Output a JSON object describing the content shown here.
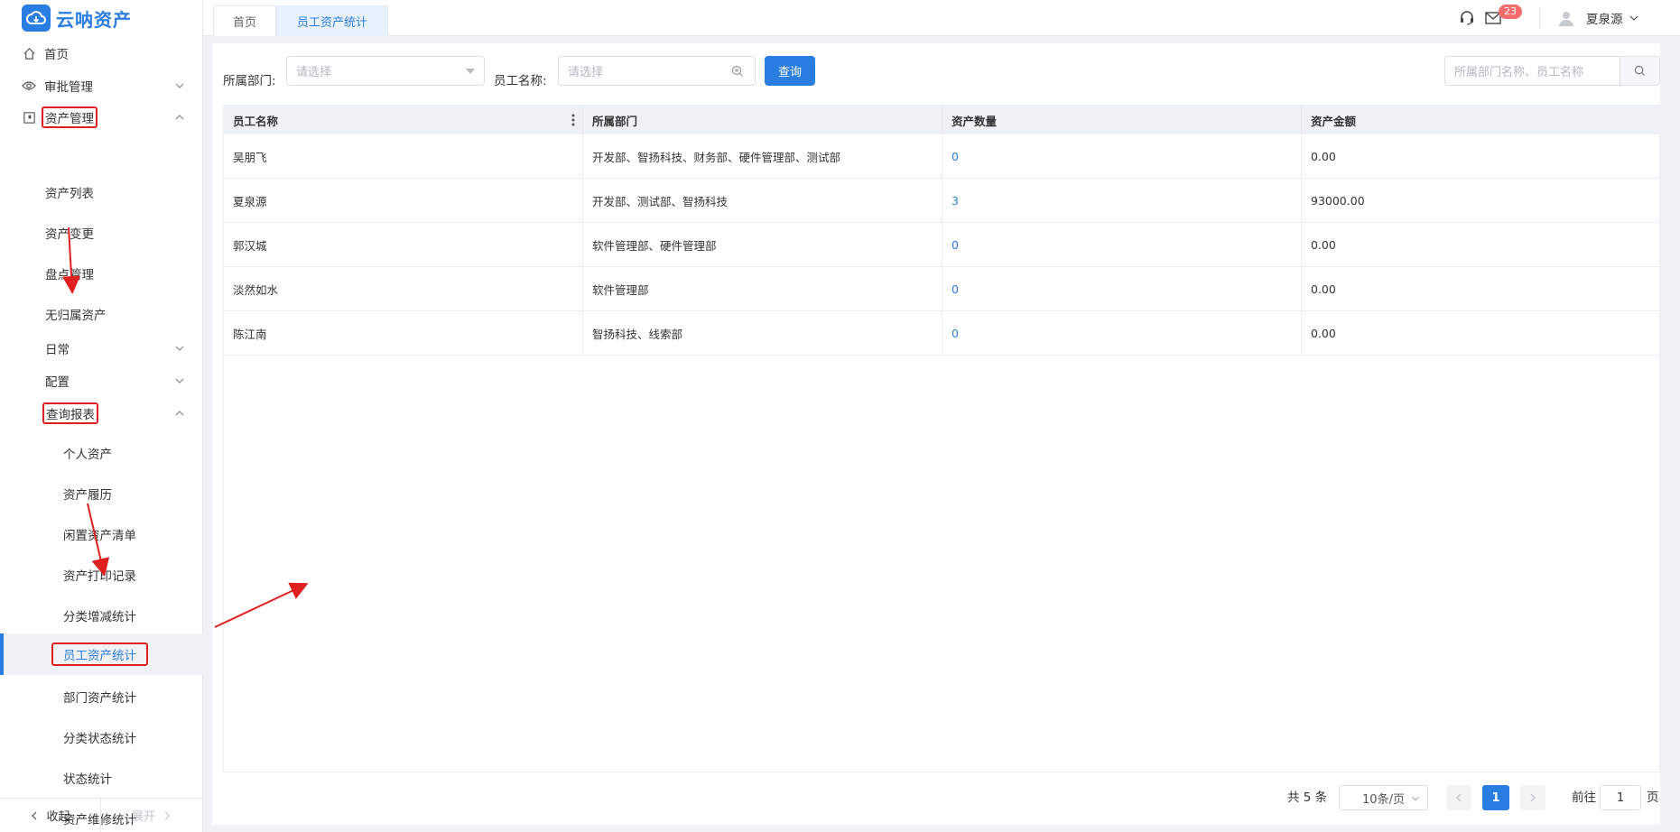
{
  "app": {
    "name": "云呐资产"
  },
  "tabs": [
    {
      "label": "首页",
      "active": false
    },
    {
      "label": "员工资产统计",
      "active": true
    }
  ],
  "header": {
    "message_count": "23",
    "username": "夏泉源"
  },
  "sidebar": {
    "items": [
      {
        "label": "首页",
        "icon": "home-icon"
      },
      {
        "label": "审批管理",
        "icon": "eye-icon"
      },
      {
        "label": "资产管理",
        "icon": "asset-icon"
      },
      {
        "label": "资产列表"
      },
      {
        "label": "资产变更"
      },
      {
        "label": "盘点管理"
      },
      {
        "label": "无归属资产"
      },
      {
        "label": "日常"
      },
      {
        "label": "配置"
      },
      {
        "label": "查询报表"
      },
      {
        "label": "个人资产"
      },
      {
        "label": "资产履历"
      },
      {
        "label": "闲置资产清单"
      },
      {
        "label": "资产打印记录"
      },
      {
        "label": "分类增减统计"
      },
      {
        "label": "员工资产统计",
        "active": true
      },
      {
        "label": "部门资产统计"
      },
      {
        "label": "分类状态统计"
      },
      {
        "label": "状态统计"
      },
      {
        "label": "资产维修统计"
      }
    ],
    "collapse_label": "收起",
    "expand_label": "展开"
  },
  "filters": {
    "dept_label": "所属部门:",
    "dept_placeholder": "请选择",
    "name_label": "员工名称:",
    "name_placeholder": "请选择",
    "query_button": "查询",
    "search_placeholder": "所属部门名称、员工名称"
  },
  "table": {
    "columns": [
      "员工名称",
      "所属部门",
      "资产数量",
      "资产金额"
    ],
    "rows": [
      {
        "name": "吴朋飞",
        "dept": "开发部、智扬科技、财务部、硬件管理部、测试部",
        "count": "0",
        "amount": "0.00"
      },
      {
        "name": "夏泉源",
        "dept": "开发部、测试部、智扬科技",
        "count": "3",
        "amount": "93000.00"
      },
      {
        "name": "郭汉城",
        "dept": "软件管理部、硬件管理部",
        "count": "0",
        "amount": "0.00"
      },
      {
        "name": "淡然如水",
        "dept": "软件管理部",
        "count": "0",
        "amount": "0.00"
      },
      {
        "name": "陈江南",
        "dept": "智扬科技、线索部",
        "count": "0",
        "amount": "0.00"
      }
    ]
  },
  "pager": {
    "total": "共 5 条",
    "page_size": "10条/页",
    "current_page": "1",
    "goto_prefix": "前往",
    "goto_value": "1",
    "goto_suffix": "页"
  },
  "colors": {
    "accent": "#2a7de1",
    "annotation": "#e02020",
    "badge": "#f56c6c"
  }
}
